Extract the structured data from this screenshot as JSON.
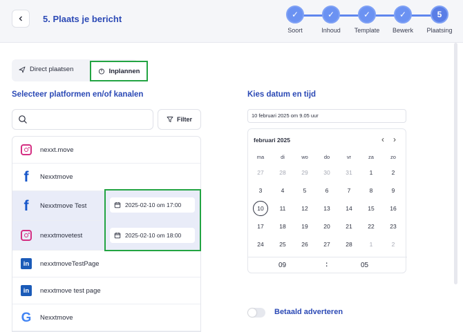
{
  "header": {
    "title": "5. Plaats je bericht",
    "steps": [
      {
        "label": "Soort",
        "done": true
      },
      {
        "label": "Inhoud",
        "done": true
      },
      {
        "label": "Template",
        "done": true
      },
      {
        "label": "Bewerk",
        "done": true
      },
      {
        "label": "Plaatsing",
        "done": false,
        "number": "5"
      }
    ]
  },
  "mode": {
    "direct_label": "Direct plaatsen",
    "schedule_label": "Inplannen",
    "selected": "Inplannen"
  },
  "platforms": {
    "title": "Selecteer platformen en/of kanalen",
    "filter_label": "Filter",
    "channels": [
      {
        "name": "nexxt.move",
        "icon": "instagram-icon"
      },
      {
        "name": "Nexxtmove",
        "icon": "facebook-icon"
      },
      {
        "name": "Nexxtmove Test",
        "icon": "facebook-icon",
        "selected": true,
        "datetime": "2025-02-10 om 17:00"
      },
      {
        "name": "nexxtmovetest",
        "icon": "instagram-icon",
        "selected": true,
        "datetime": "2025-02-10 om 18:00"
      },
      {
        "name": "nexxtmoveTestPage",
        "icon": "linkedin-icon"
      },
      {
        "name": "nexxtmove test page",
        "icon": "linkedin-icon"
      },
      {
        "name": "Nexxtmove",
        "icon": "google-icon"
      }
    ]
  },
  "schedule": {
    "title": "Kies datum en tijd",
    "date_value": "10 februari 2025 om 9.05 uur",
    "calendar": {
      "month": "februari 2025",
      "weekdays": [
        "ma",
        "di",
        "wo",
        "do",
        "vr",
        "za",
        "zo"
      ],
      "weeks": [
        [
          "27",
          "28",
          "29",
          "30",
          "31",
          "1",
          "2"
        ],
        [
          "3",
          "4",
          "5",
          "6",
          "7",
          "8",
          "9"
        ],
        [
          "10",
          "11",
          "12",
          "13",
          "14",
          "15",
          "16"
        ],
        [
          "17",
          "18",
          "19",
          "20",
          "21",
          "22",
          "23"
        ],
        [
          "24",
          "25",
          "26",
          "27",
          "28",
          "1",
          "2"
        ]
      ],
      "selected_day": "10",
      "hour": "09",
      "separator": ":",
      "minute": "05"
    }
  },
  "ads": {
    "label": "Betaald adverteren",
    "enabled": false
  },
  "colors": {
    "accent": "#2b49b5",
    "step": "#6b92f2",
    "highlight": "#22a442"
  }
}
